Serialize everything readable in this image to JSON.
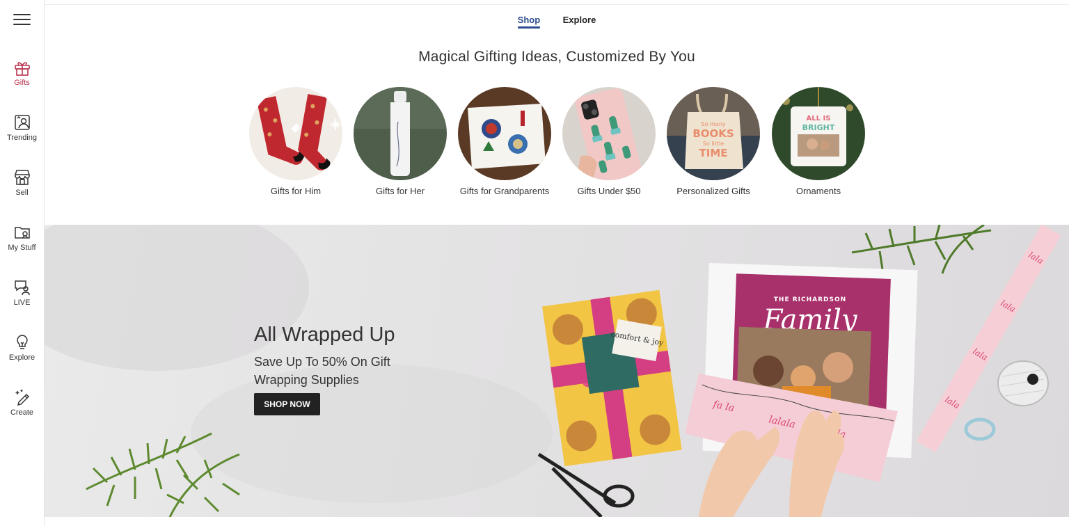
{
  "sidebar": {
    "items": [
      {
        "label": "Gifts",
        "icon": "gift-icon"
      },
      {
        "label": "Trending",
        "icon": "trending-icon"
      },
      {
        "label": "Sell",
        "icon": "store-icon"
      },
      {
        "label": "My Stuff",
        "icon": "folder-icon"
      },
      {
        "label": "LIVE",
        "icon": "live-chat-icon"
      },
      {
        "label": "Explore",
        "icon": "lightbulb-icon"
      },
      {
        "label": "Create",
        "icon": "create-pen-icon"
      }
    ]
  },
  "tabs": [
    {
      "label": "Shop",
      "active": true
    },
    {
      "label": "Explore",
      "active": false
    }
  ],
  "headline": "Magical Gifting Ideas, Customized By You",
  "categories": [
    {
      "label": "Gifts for Him"
    },
    {
      "label": "Gifts for Her"
    },
    {
      "label": "Gifts for Grandparents"
    },
    {
      "label": "Gifts Under $50"
    },
    {
      "label": "Personalized Gifts"
    },
    {
      "label": "Ornaments"
    }
  ],
  "banner": {
    "title": "All Wrapped Up",
    "subtitle": "Save Up To 50% On Gift Wrapping Supplies",
    "button": "SHOP NOW",
    "tag_text": "comfort & joy",
    "card_heading": "THE RICHARDSON",
    "card_script": "Family",
    "roll_text": "lalala"
  },
  "thumbs": {
    "books_text": "So many BOOKS So little TIME",
    "ornament_text": "ALL IS BRIGHT"
  },
  "colors": {
    "accent": "#b8344f",
    "tab_active": "#2c4d8f",
    "button_bg": "#222222"
  }
}
